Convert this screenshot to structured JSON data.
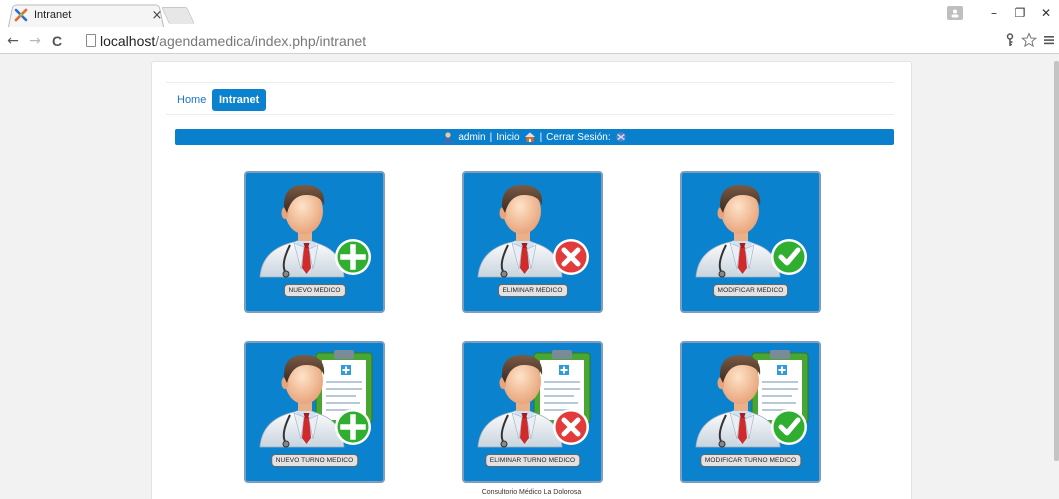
{
  "browser": {
    "tab_title": "Intranet",
    "tab_close": "×",
    "url_host": "localhost",
    "url_path": "/agendamedica/index.php/intranet",
    "back": "←",
    "forward": "→",
    "reload": "C",
    "win_min": "–",
    "win_restore": "❐",
    "win_close": "✕",
    "icons": [
      "back-arrow-icon",
      "forward-arrow-icon",
      "reload-icon",
      "page-icon",
      "key-icon",
      "star-icon",
      "menu-icon"
    ]
  },
  "nav": {
    "home_label": "Home",
    "intranet_label": "Intranet"
  },
  "userbar": {
    "user": "admin",
    "sep1": "|",
    "inicio": "Inicio",
    "sep2": "|",
    "cerrar": "Cerrar Sesión:"
  },
  "tiles": [
    {
      "label": "NUEVO MEDICO",
      "badge": "plus",
      "clipboard": false
    },
    {
      "label": "ELIMINAR MEDICO",
      "badge": "x",
      "clipboard": false
    },
    {
      "label": "MODIFICAR MEDICO",
      "badge": "check",
      "clipboard": false
    },
    {
      "label": "NUEVO TURNO MEDICO",
      "badge": "plus",
      "clipboard": true
    },
    {
      "label": "ELIMINAR TURNO MEDICO",
      "badge": "x",
      "clipboard": true
    },
    {
      "label": "MODIFICAR TURNO MEDICO",
      "badge": "check",
      "clipboard": true
    }
  ],
  "footer": "Consultorio Médico La Dolorosa",
  "colors": {
    "accent": "#0a82cd",
    "badge_plus": "#2fae2f",
    "badge_x": "#e33b3b",
    "badge_check": "#2fae2f"
  }
}
